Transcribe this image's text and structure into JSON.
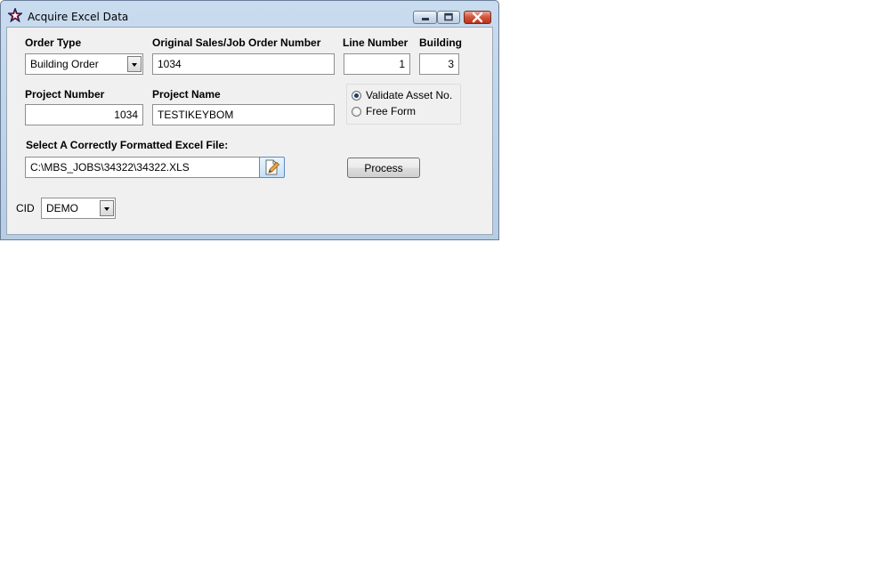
{
  "window": {
    "title": "Acquire Excel Data",
    "icon": "star-icon"
  },
  "form": {
    "order_type": {
      "label": "Order Type",
      "value": "Building Order"
    },
    "order_number": {
      "label": "Original Sales/Job Order Number",
      "value": "1034"
    },
    "line_number": {
      "label": "Line Number",
      "value": "1"
    },
    "building": {
      "label": "Building",
      "value": "3"
    },
    "project_number": {
      "label": "Project Number",
      "value": "1034"
    },
    "project_name": {
      "label": "Project Name",
      "value": "TESTIKEYBOM"
    },
    "mode": {
      "options": [
        "Validate Asset No.",
        "Free Form"
      ],
      "selected": "Validate Asset No."
    },
    "excel_file": {
      "label": "Select  A Correctly Formatted Excel File:",
      "value": "C:\\MBS_JOBS\\34322\\34322.XLS"
    },
    "process_button": "Process",
    "cid": {
      "label": "CID",
      "value": "DEMO"
    }
  },
  "colors": {
    "title_bar": "#c9dcef",
    "client_bg": "#f0f0f0",
    "close_button": "#c8452e"
  }
}
